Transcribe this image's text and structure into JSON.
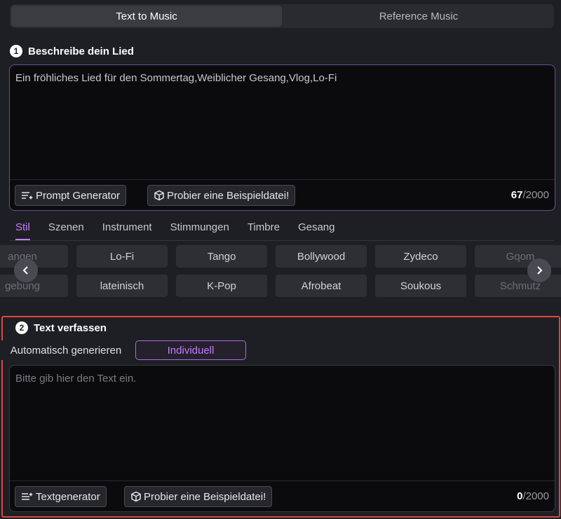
{
  "mode_tabs": [
    {
      "label": "Text to Music",
      "active": true
    },
    {
      "label": "Reference Music",
      "active": false
    }
  ],
  "describe": {
    "step": "1",
    "title": "Beschreibe dein Lied",
    "prompt_text": "Ein fröhliches Lied für den Sommertag,Weiblicher Gesang,Vlog,Lo-Fi",
    "prompt_generator_label": "Prompt Generator",
    "example_label": "Probier eine Beispieldatei!",
    "count": "67",
    "max": "/2000"
  },
  "categories": [
    "Stil",
    "Szenen",
    "Instrument",
    "Stimmungen",
    "Timbre",
    "Gesang"
  ],
  "active_category": "Stil",
  "tags_row1": [
    "angen",
    "Lo-Fi",
    "Tango",
    "Bollywood",
    "Zydeco",
    "Gqom"
  ],
  "tags_row2": [
    "gebung",
    "lateinisch",
    "K-Pop",
    "Afrobeat",
    "Soukous",
    "Schmutz"
  ],
  "lyrics": {
    "step": "2",
    "title": "Text verfassen",
    "auto_label": "Automatisch generieren",
    "custom_label": "Individuell",
    "placeholder": "Bitte gib hier den Text ein.",
    "text_generator_label": "Textgenerator",
    "example_label": "Probier eine Beispieldatei!",
    "count": "0",
    "max": "/2000"
  },
  "colors": {
    "accent": "#c77dff",
    "highlight_border": "#e0463c"
  },
  "icons": {
    "prev": "chevron-left-icon",
    "next": "chevron-right-icon",
    "generator": "sparkle-lines-icon",
    "example": "cube-icon"
  }
}
